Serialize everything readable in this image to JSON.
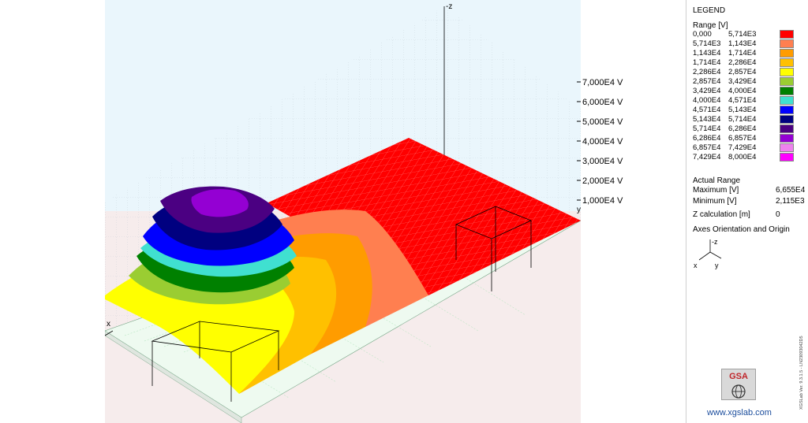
{
  "view": {
    "z_axis_label": "-z",
    "x_axis_label": "x",
    "y_axis_label": "y",
    "z_ticks": [
      "7,000E4 V",
      "6,000E4 V",
      "5,000E4 V",
      "4,000E4 V",
      "3,000E4 V",
      "2,000E4 V",
      "1,000E4 V"
    ]
  },
  "legend": {
    "title": "LEGEND",
    "range_header": "Range [V]",
    "rows": [
      {
        "from": "0,000",
        "to": "5,714E3",
        "color": "#ff0000"
      },
      {
        "from": "5,714E3",
        "to": "1,143E4",
        "color": "#ff7f50"
      },
      {
        "from": "1,143E4",
        "to": "1,714E4",
        "color": "#ff9c00"
      },
      {
        "from": "1,714E4",
        "to": "2,286E4",
        "color": "#ffc000"
      },
      {
        "from": "2,286E4",
        "to": "2,857E4",
        "color": "#ffff00"
      },
      {
        "from": "2,857E4",
        "to": "3,429E4",
        "color": "#9acd32"
      },
      {
        "from": "3,429E4",
        "to": "4,000E4",
        "color": "#008000"
      },
      {
        "from": "4,000E4",
        "to": "4,571E4",
        "color": "#40e0d0"
      },
      {
        "from": "4,571E4",
        "to": "5,143E4",
        "color": "#0000ff"
      },
      {
        "from": "5,143E4",
        "to": "5,714E4",
        "color": "#000080"
      },
      {
        "from": "5,714E4",
        "to": "6,286E4",
        "color": "#4b0082"
      },
      {
        "from": "6,286E4",
        "to": "6,857E4",
        "color": "#9400d3"
      },
      {
        "from": "6,857E4",
        "to": "7,429E4",
        "color": "#ee82ee"
      },
      {
        "from": "7,429E4",
        "to": "8,000E4",
        "color": "#ff00ff"
      }
    ],
    "actual_range": "Actual Range",
    "maximum_label": "Maximum [V]",
    "maximum_value": "6,655E4",
    "minimum_label": "Minimum [V]",
    "minimum_value": "2,115E3",
    "zcalc_label": "Z calculation [m]",
    "zcalc_value": "0",
    "axes_title": "Axes Orientation and Origin",
    "axes_z": "-z",
    "axes_x": "x",
    "axes_y": "y",
    "logo_text": "GSA",
    "website": "www.xgslab.com",
    "version": "XGSLab Ver. 9.3.1.5 - LN23093042D5"
  },
  "colors": {
    "background_top": "#eaf6fc",
    "background_bottom": "#f6ecec",
    "floor_grid": "#a9e3b6",
    "wall_grid": "#b9c6cf"
  }
}
